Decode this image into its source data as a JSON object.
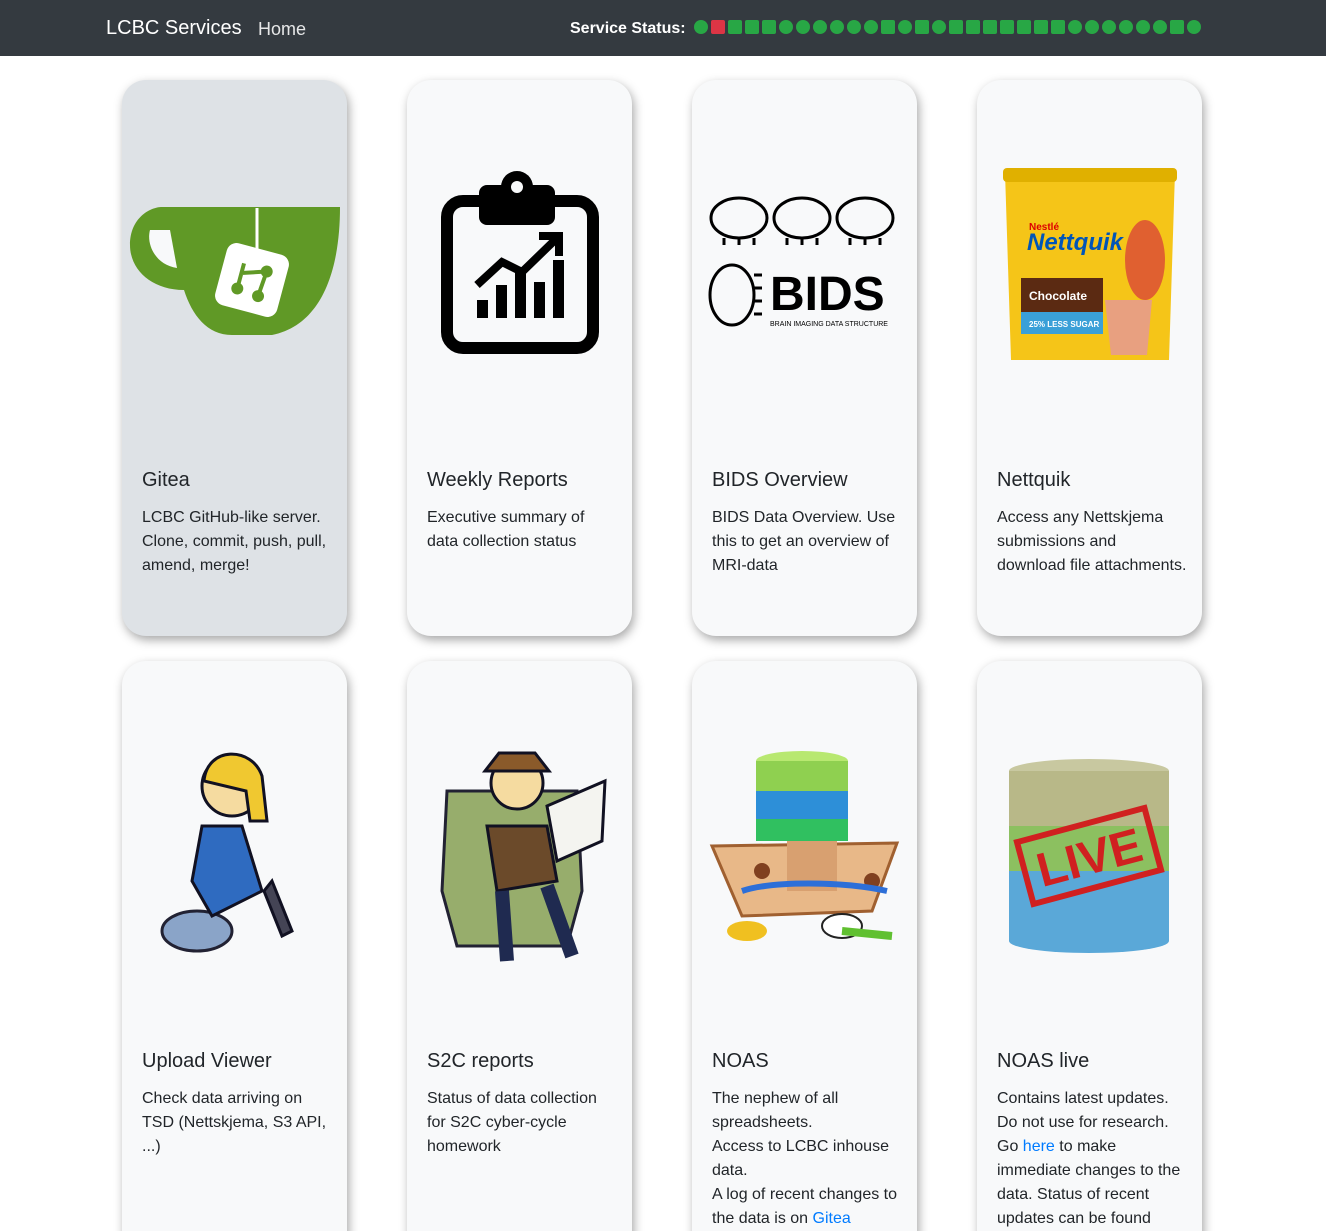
{
  "navbar": {
    "brand": "LCBC Services",
    "home": "Home",
    "status_label": "Service Status:",
    "status_indicators": [
      {
        "shape": "dot",
        "color": "#28a745"
      },
      {
        "shape": "square",
        "color": "#dc3545"
      },
      {
        "shape": "square",
        "color": "#28a745"
      },
      {
        "shape": "square",
        "color": "#28a745"
      },
      {
        "shape": "square",
        "color": "#28a745"
      },
      {
        "shape": "dot",
        "color": "#28a745"
      },
      {
        "shape": "dot",
        "color": "#28a745"
      },
      {
        "shape": "dot",
        "color": "#28a745"
      },
      {
        "shape": "dot",
        "color": "#28a745"
      },
      {
        "shape": "dot",
        "color": "#28a745"
      },
      {
        "shape": "dot",
        "color": "#28a745"
      },
      {
        "shape": "square",
        "color": "#28a745"
      },
      {
        "shape": "dot",
        "color": "#28a745"
      },
      {
        "shape": "square",
        "color": "#28a745"
      },
      {
        "shape": "dot",
        "color": "#28a745"
      },
      {
        "shape": "square",
        "color": "#28a745"
      },
      {
        "shape": "square",
        "color": "#28a745"
      },
      {
        "shape": "square",
        "color": "#28a745"
      },
      {
        "shape": "square",
        "color": "#28a745"
      },
      {
        "shape": "square",
        "color": "#28a745"
      },
      {
        "shape": "square",
        "color": "#28a745"
      },
      {
        "shape": "square",
        "color": "#28a745"
      },
      {
        "shape": "dot",
        "color": "#28a745"
      },
      {
        "shape": "dot",
        "color": "#28a745"
      },
      {
        "shape": "dot",
        "color": "#28a745"
      },
      {
        "shape": "dot",
        "color": "#28a745"
      },
      {
        "shape": "dot",
        "color": "#28a745"
      },
      {
        "shape": "dot",
        "color": "#28a745"
      },
      {
        "shape": "square",
        "color": "#28a745"
      },
      {
        "shape": "dot",
        "color": "#28a745"
      }
    ]
  },
  "cards": {
    "gitea": {
      "title": "Gitea",
      "text": "LCBC GitHub-like server. Clone, commit, push, pull, amend, merge!",
      "icon": "gitea-teacup-icon"
    },
    "weekly": {
      "title": "Weekly Reports",
      "text": "Executive summary of data collection status",
      "icon": "clipboard-chart-icon"
    },
    "bids": {
      "title": "BIDS Overview",
      "text": "BIDS Data Overview. Use this to get an overview of MRI-data",
      "icon": "bids-logo",
      "logo_text": "BIDS",
      "logo_subtext": "BRAIN IMAGING DATA STRUCTURE"
    },
    "nettquik": {
      "title": "Nettquik",
      "text": "Access any Nettskjema submissions and download file attachments.",
      "icon": "nettquik-tub-image",
      "logo_top": "Nestlé",
      "logo_text": "Nettquik",
      "logo_flavor": "Chocolate",
      "logo_band": "25% LESS SUGAR"
    },
    "upload": {
      "title": "Upload Viewer",
      "text": "Check data arriving on TSD (Nettskjema, S3 API, ...)",
      "icon": "vault-boy-explorer-image"
    },
    "s2c": {
      "title": "S2C reports",
      "text": "Status of data collection for S2C cyber-cycle homework",
      "icon": "vault-boy-reading-image"
    },
    "noas": {
      "title": "NOAS",
      "line1": "The nephew of all spreadsheets.",
      "line2": "Access to LCBC inhouse data.",
      "line3": "A log of recent changes to the data is on",
      "line3_link": "Gitea",
      "icon": "noah-ark-database-image"
    },
    "noaslive": {
      "title": "NOAS live",
      "text_before": "Contains latest updates. Do not use for research. Go",
      "link": "here",
      "text_after": "to make immediate changes to the data. Status of recent updates can be found",
      "stamp": "LIVE",
      "icon": "live-database-image"
    }
  }
}
